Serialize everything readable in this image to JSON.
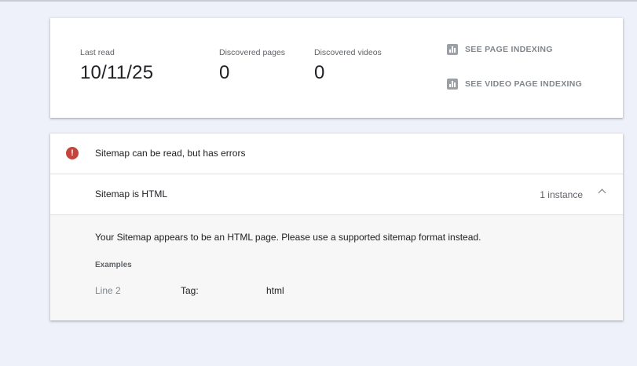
{
  "stats": {
    "last_read_label": "Last read",
    "last_read_value": "10/11/25",
    "discovered_pages_label": "Discovered pages",
    "discovered_pages_value": "0",
    "discovered_videos_label": "Discovered videos",
    "discovered_videos_value": "0"
  },
  "links": {
    "page_indexing": "SEE PAGE INDEXING",
    "video_page_indexing": "SEE VIDEO PAGE INDEXING",
    "icon": "bar-chart-icon"
  },
  "issues": {
    "error_icon": "error-icon",
    "status_text": "Sitemap can be read, but has errors",
    "issue_title": "Sitemap is HTML",
    "instances": "1 instance",
    "description": "Your Sitemap appears to be an HTML page. Please use a supported sitemap format instead.",
    "examples_label": "Examples",
    "example": {
      "line": "Line 2",
      "tag_label": "Tag:",
      "tag_value": "html"
    }
  },
  "colors": {
    "background": "#eef1f9",
    "error": "#c5443b",
    "muted_link": "#80868b"
  }
}
